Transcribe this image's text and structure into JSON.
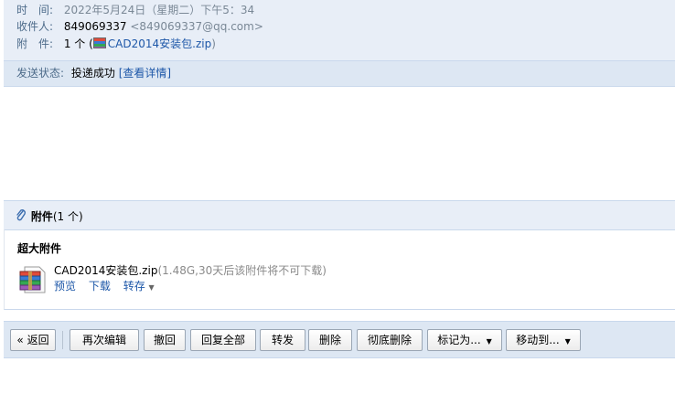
{
  "header": {
    "time_label": "时　间:",
    "time_value": "2022年5月24日（星期二）下午5：34",
    "to_label": "收件人:",
    "to_name": "849069337",
    "to_email": "<849069337@qq.com>",
    "attach_label": "附　件:",
    "attach_count": "1 个 (",
    "attach_file": "CAD2014安装包.zip",
    "attach_close": ")",
    "status_label": "发送状态:",
    "status_value": "投递成功",
    "status_detail": "[查看详情]"
  },
  "attachments": {
    "title": "附件",
    "count": "(1 个)",
    "section_title": "超大附件",
    "file_name": "CAD2014安装包.zip",
    "file_meta": "(1.48G,30天后该附件将不可下载)",
    "preview": "预览",
    "download": "下载",
    "forward": "转存"
  },
  "toolbar": {
    "back": "« 返回",
    "re_edit": "再次编辑",
    "recall": "撤回",
    "reply_all": "回复全部",
    "forward": "转发",
    "delete": "删除",
    "delete_perm": "彻底删除",
    "mark_as": "标记为...",
    "move_to": "移动到..."
  }
}
